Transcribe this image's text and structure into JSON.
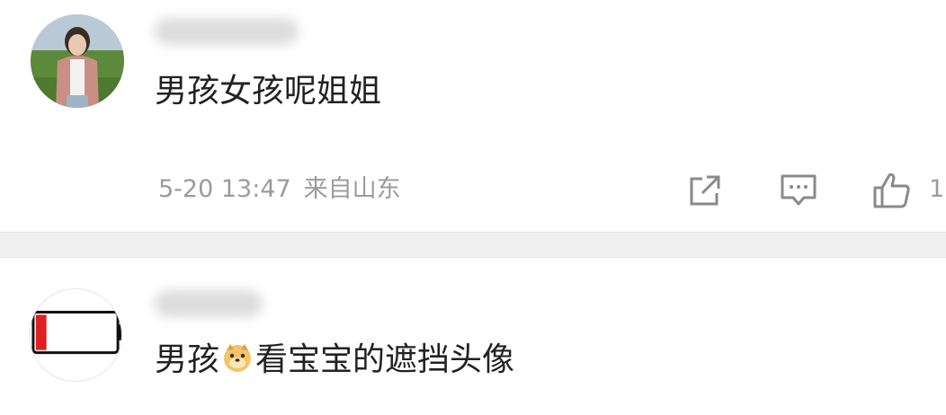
{
  "comments": [
    {
      "text": "男孩女孩呢姐姐",
      "time": "5-20 13:47",
      "location": "来自山东",
      "likes": "1",
      "avatar": "photo-avatar"
    },
    {
      "text_before": "男孩",
      "emoji": "doge-emoji",
      "text_after": "看宝宝的遮挡头像",
      "avatar": "battery-avatar"
    }
  ],
  "icons": {
    "share": "share-icon",
    "reply": "reply-icon",
    "like": "thumbs-up-icon"
  },
  "colors": {
    "meta_text": "#9b9b9b",
    "battery_red": "#e02020",
    "divider": "#f0f0f0"
  }
}
